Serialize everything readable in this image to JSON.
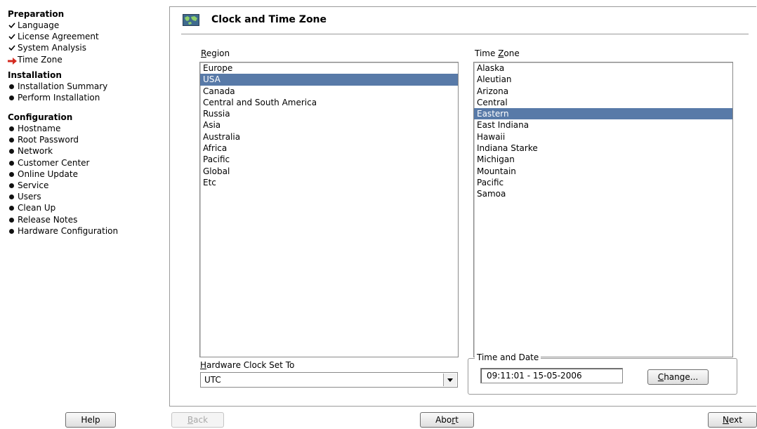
{
  "sidebar": {
    "preparation": {
      "heading": "Preparation",
      "items": [
        {
          "label": "Language",
          "state": "done"
        },
        {
          "label": "License Agreement",
          "state": "done"
        },
        {
          "label": "System Analysis",
          "state": "done"
        },
        {
          "label": "Time Zone",
          "state": "current"
        }
      ]
    },
    "installation": {
      "heading": "Installation",
      "items": [
        {
          "label": "Installation Summary",
          "state": "pending"
        },
        {
          "label": "Perform Installation",
          "state": "pending"
        }
      ]
    },
    "configuration": {
      "heading": "Configuration",
      "items": [
        {
          "label": "Hostname",
          "state": "pending"
        },
        {
          "label": "Root Password",
          "state": "pending"
        },
        {
          "label": "Network",
          "state": "pending"
        },
        {
          "label": "Customer Center",
          "state": "pending"
        },
        {
          "label": "Online Update",
          "state": "pending"
        },
        {
          "label": "Service",
          "state": "pending"
        },
        {
          "label": "Users",
          "state": "pending"
        },
        {
          "label": "Clean Up",
          "state": "pending"
        },
        {
          "label": "Release Notes",
          "state": "pending"
        },
        {
          "label": "Hardware Configuration",
          "state": "pending"
        }
      ]
    }
  },
  "main": {
    "title": "Clock and Time Zone",
    "region": {
      "label_mnemonic": "R",
      "label_rest": "egion",
      "items": [
        "Europe",
        "USA",
        "Canada",
        "Central and South America",
        "Russia",
        "Asia",
        "Australia",
        "Africa",
        "Pacific",
        "Global",
        "Etc"
      ],
      "selected": "USA"
    },
    "timezone": {
      "label_pre": "Time ",
      "label_mnemonic": "Z",
      "label_rest": "one",
      "items": [
        "Alaska",
        "Aleutian",
        "Arizona",
        "Central",
        "Eastern",
        "East Indiana",
        "Hawaii",
        "Indiana Starke",
        "Michigan",
        "Mountain",
        "Pacific",
        "Samoa"
      ],
      "selected": "Eastern"
    },
    "hardware_clock": {
      "label_mnemonic": "H",
      "label_rest": "ardware Clock Set To",
      "value": "UTC"
    },
    "time_and_date": {
      "legend": "Time and Date",
      "value": "09:11:01 - 15-05-2006",
      "change_mnemonic": "C",
      "change_rest": "hange..."
    }
  },
  "footer": {
    "help": "Help",
    "back_mnemonic": "B",
    "back_rest": "ack",
    "abort_pre": "Abo",
    "abort_mnemonic": "r",
    "abort_rest": "t",
    "next_mnemonic": "N",
    "next_rest": "ext"
  },
  "colors": {
    "selection": "#587aa8",
    "current_step_arrow": "#d42a20"
  },
  "icons": {
    "done": "check-icon",
    "current": "arrow-right-icon",
    "pending": "bullet-icon",
    "title": "timezone-map-icon",
    "combo": "chevron-down-icon"
  }
}
